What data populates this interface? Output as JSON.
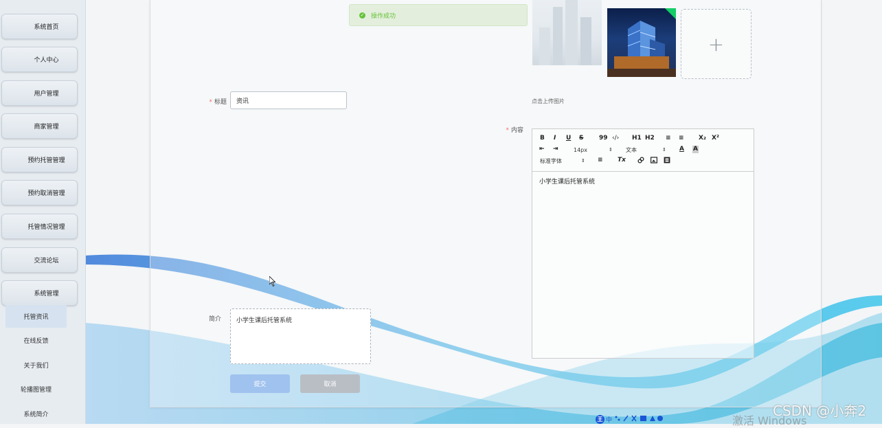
{
  "sidebar": {
    "items": [
      {
        "label": "系统首页"
      },
      {
        "label": "个人中心"
      },
      {
        "label": "用户管理"
      },
      {
        "label": "商家管理"
      },
      {
        "label": "预约托管管理"
      },
      {
        "label": "预约取消管理"
      },
      {
        "label": "托管情况管理"
      },
      {
        "label": "交流论坛"
      },
      {
        "label": "系统管理"
      }
    ],
    "subitems": [
      {
        "label": "托管资讯",
        "active": true
      },
      {
        "label": "在线反馈"
      },
      {
        "label": "关于我们"
      },
      {
        "label": "轮播图管理"
      },
      {
        "label": "系统简介"
      }
    ]
  },
  "toast": {
    "message": "操作成功",
    "color": "#67c23a"
  },
  "form": {
    "title_label": "标题",
    "title_value": "资讯",
    "intro_label": "简介",
    "intro_value": "小学生课后托管系统",
    "content_label": "内容",
    "upload_tip": "点击上传图片",
    "upload_plus": "+",
    "required_mark": "*"
  },
  "editor": {
    "toolbar": {
      "bold": "B",
      "italic": "I",
      "underline": "U",
      "strike": "S",
      "blockquote": "99",
      "code": "‹/›",
      "h1": "H1",
      "h2": "H2",
      "ordered_list": "≡",
      "bullet_list": "≡",
      "subscript": "X₂",
      "superscript": "X²",
      "indent_out": "⇤",
      "indent_in": "⇥",
      "size": "14px",
      "header": "文本",
      "font": "标准字体",
      "color": "A",
      "background": "A",
      "align": "≡",
      "clean": "Tx",
      "arrow": "⇕"
    },
    "content": "小学生课后托管系统"
  },
  "buttons": {
    "submit": "提交",
    "cancel": "取消"
  },
  "ime": {
    "badge": "王",
    "mode": "中"
  },
  "watermark": "激活 Windows",
  "csdn": "CSDN @小奔2",
  "colors": {
    "primary": "#a0c2ef",
    "success": "#13ce66",
    "sidebar": "#e7ecf1"
  }
}
